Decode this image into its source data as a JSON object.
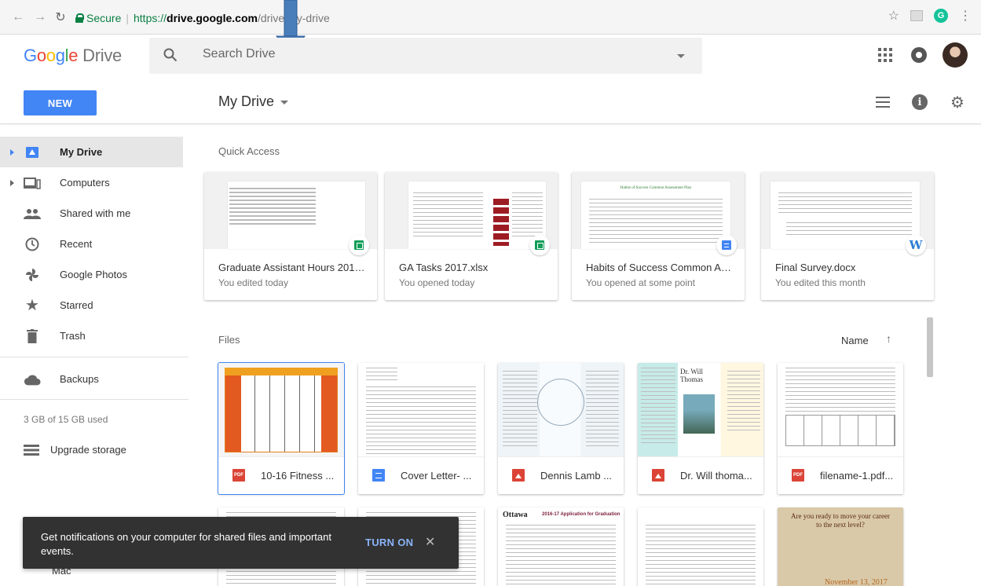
{
  "browser": {
    "secure_label": "Secure",
    "url_scheme": "https://",
    "url_host": "drive.google.com",
    "url_path": "/drive/my-drive"
  },
  "header": {
    "logo_letters": [
      "G",
      "o",
      "o",
      "g",
      "l",
      "e"
    ],
    "logo_product": "Drive",
    "search_placeholder": "Search Drive"
  },
  "toolbar": {
    "new_label": "NEW",
    "title": "My Drive"
  },
  "sidebar": {
    "items": [
      {
        "label": "My Drive",
        "icon": "my-drive-icon"
      },
      {
        "label": "Computers",
        "icon": "computers-icon"
      },
      {
        "label": "Shared with me",
        "icon": "shared-icon"
      },
      {
        "label": "Recent",
        "icon": "clock-icon"
      },
      {
        "label": "Google Photos",
        "icon": "photos-icon"
      },
      {
        "label": "Starred",
        "icon": "star-icon"
      },
      {
        "label": "Trash",
        "icon": "trash-icon"
      },
      {
        "label": "Backups",
        "icon": "cloud-icon"
      }
    ],
    "storage": "3 GB of 15 GB used",
    "upgrade_label": "Upgrade storage",
    "mac_label": "Mac"
  },
  "quick_access": {
    "label": "Quick Access",
    "cards": [
      {
        "name": "Graduate Assistant Hours 2015-...",
        "sub": "You edited today",
        "badge": "sheet"
      },
      {
        "name": "GA Tasks 2017.xlsx",
        "sub": "You opened today",
        "badge": "sheet"
      },
      {
        "name": "Habits of Success Common Ass...",
        "sub": "You opened at some point",
        "badge": "doc"
      },
      {
        "name": "Final Survey.docx",
        "sub": "You edited this month",
        "badge": "word"
      }
    ]
  },
  "files": {
    "label": "Files",
    "sort_label": "Name",
    "sort_arrow": "↑",
    "items": [
      {
        "name": "10-16 Fitness ...",
        "type": "pdf"
      },
      {
        "name": "Cover Letter- ...",
        "type": "doc"
      },
      {
        "name": "Dennis Lamb ...",
        "type": "img"
      },
      {
        "name": "Dr. Will thoma...",
        "type": "img"
      },
      {
        "name": "filename-1.pdf...",
        "type": "pdf"
      }
    ]
  },
  "thumb_text": {
    "thomas_name": "Dr. Will Thomas",
    "ottawa": "Ottawa",
    "graduation": "2016-17 Application for Graduation",
    "career_1": "Are you ready to move your career",
    "career_2": "to the next level?",
    "career_date": "November 13, 2017",
    "habits_title": "Habits of Success Common Assessment Plan"
  },
  "toast": {
    "text": "Get notifications on your computer for shared files and important events.",
    "action": "TURN ON",
    "close": "✕"
  },
  "colors": {
    "accent": "#4285f4",
    "active_nav": "#e6e6e6",
    "secure_green": "#0b8043"
  }
}
